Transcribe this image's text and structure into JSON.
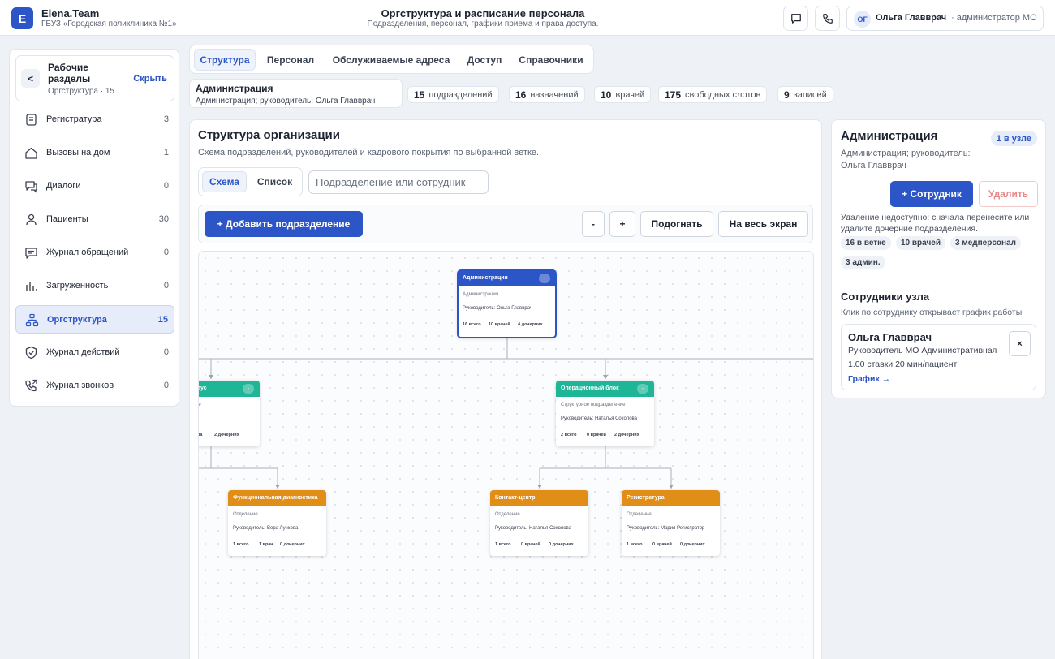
{
  "header": {
    "logo_letter": "E",
    "brand": "Elena.Team",
    "org": "ГБУЗ «Городская поликлиника №1»",
    "title": "Оргструктура и расписание персонала",
    "subtitle": "Подразделения, персонал, графики приема и права доступа.",
    "user_initials": "ОГ",
    "user_name": "Ольга Главврач",
    "user_role": "· администратор МО"
  },
  "sidebar": {
    "collapse_label": "<",
    "title": "Рабочие разделы",
    "subtitle": "Оргструктура · 15",
    "hide_label": "Скрыть",
    "items": [
      {
        "label": "Регистратура",
        "count": "3",
        "icon": "registry-icon"
      },
      {
        "label": "Вызовы на дом",
        "count": "1",
        "icon": "home-icon"
      },
      {
        "label": "Диалоги",
        "count": "0",
        "icon": "dialogs-icon"
      },
      {
        "label": "Пациенты",
        "count": "30",
        "icon": "user-icon"
      },
      {
        "label": "Журнал обращений",
        "count": "0",
        "icon": "message-icon"
      },
      {
        "label": "Загруженность",
        "count": "0",
        "icon": "bar-chart-icon"
      },
      {
        "label": "Оргструктура",
        "count": "15",
        "icon": "org-chart-icon",
        "active": true
      },
      {
        "label": "Журнал действий",
        "count": "0",
        "icon": "shield-icon"
      },
      {
        "label": "Журнал звонков",
        "count": "0",
        "icon": "phone-call-icon"
      }
    ]
  },
  "tabs": [
    "Структура",
    "Персонал",
    "Обслуживаемые адреса",
    "Доступ",
    "Справочники"
  ],
  "crumb": {
    "title": "Администрация",
    "subtitle": "Администрация; руководитель: Ольга Главврач"
  },
  "stats": [
    {
      "value": "15",
      "label": "подразделений"
    },
    {
      "value": "16",
      "label": "назначений"
    },
    {
      "value": "10",
      "label": "врачей"
    },
    {
      "value": "175",
      "label": "свободных слотов"
    },
    {
      "value": "9",
      "label": "записей"
    }
  ],
  "main": {
    "title": "Структура организации",
    "subtitle": "Схема подразделений, руководителей и кадрового покрытия по выбранной ветке.",
    "view_schema": "Схема",
    "view_list": "Список",
    "search_placeholder": "Подразделение или сотрудник",
    "add_unit": "+ Добавить подразделение",
    "zoom_out": "-",
    "zoom_in": "+",
    "fit": "Подогнать",
    "fullscreen": "На весь экран"
  },
  "nodes": [
    {
      "title": "Администрация",
      "type": "Администрация",
      "head": "Руководитель: Ольга Главврач",
      "chips": [
        "16 всего",
        "10 врачей",
        "4 дочерних"
      ],
      "toggle": "-",
      "color": "#2c56c7"
    },
    {
      "title": "ческий корпус",
      "type": "подразделение",
      "head": "Вера Лучкова",
      "chips": [
        "ра",
        "2 дочерних"
      ],
      "toggle": "-",
      "color": "#1fb597"
    },
    {
      "title": "Операционный блок",
      "type": "Структурное подразделение",
      "head": "Руководитель: Наталья Соколова",
      "chips": [
        "2 всего",
        "0 врачей",
        "2 дочерних"
      ],
      "toggle": "-",
      "color": "#1fb597"
    },
    {
      "title": "Функциональная диагностика",
      "type": "Отделение",
      "head": "Руководитель: Вера Лучкова",
      "chips": [
        "1 всего",
        "1 врач",
        "0 дочерних"
      ],
      "color": "#e08e18"
    },
    {
      "title": "Контакт-центр",
      "type": "Отделение",
      "head": "Руководитель: Наталья Соколова",
      "chips": [
        "1 всего",
        "0 врачей",
        "0 дочерних"
      ],
      "color": "#e08e18"
    },
    {
      "title": "Регистратура",
      "type": "Отделение",
      "head": "Руководитель: Мария Регистратор",
      "chips": [
        "1 всего",
        "0 врачей",
        "0 дочерних"
      ],
      "color": "#e08e18"
    }
  ],
  "right": {
    "title": "Администрация",
    "badge": "1 в узле",
    "subtitle": "Администрация; руководитель: Ольга Главврач",
    "add_employee": "+ Сотрудник",
    "delete": "Удалить",
    "note": "Удаление недоступно: сначала перенесите или удалите дочерние подразделения.",
    "chips": [
      "16 в ветке",
      "10 врачей",
      "3 медперсонал",
      "3 админ."
    ],
    "section_title": "Сотрудники узла",
    "section_sub": "Клик по сотруднику открывает график работы",
    "employee": {
      "name": "Ольга Главврач",
      "position": "Руководитель МО  Административная",
      "rate": "1.00 ставки  20 мин/пациент",
      "link": "График →",
      "close": "×"
    }
  },
  "colors": {
    "accent": "#2c56c7",
    "teal": "#1fb597",
    "orange": "#e08e18",
    "danger": "#e88a8a"
  }
}
